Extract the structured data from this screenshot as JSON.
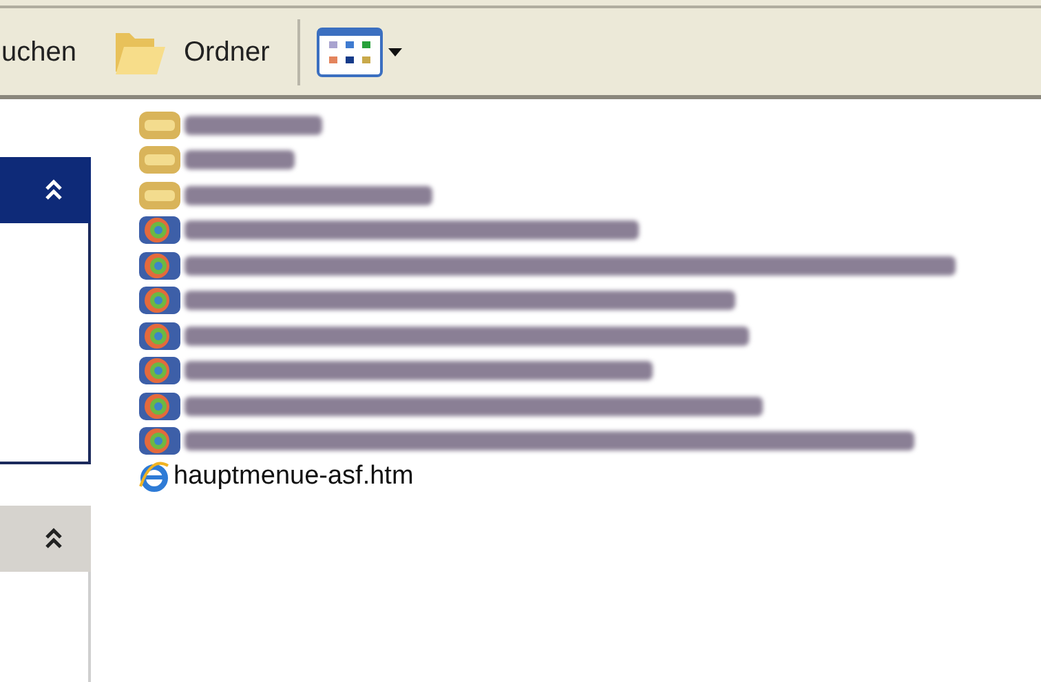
{
  "toolbar": {
    "items": [
      {
        "kind": "text",
        "label": "uchen"
      },
      {
        "kind": "folders",
        "label": "Ordner"
      },
      {
        "kind": "views"
      }
    ]
  },
  "task_panes": [
    {
      "expanded": true,
      "active": true
    },
    {
      "expanded": true,
      "active": false
    }
  ],
  "files": [
    {
      "kind": "folder",
      "blurred": true
    },
    {
      "kind": "folder",
      "blurred": true
    },
    {
      "kind": "folder",
      "blurred": true
    },
    {
      "kind": "video",
      "blurred": true
    },
    {
      "kind": "video",
      "blurred": true
    },
    {
      "kind": "video",
      "blurred": true
    },
    {
      "kind": "video",
      "blurred": true
    },
    {
      "kind": "video",
      "blurred": true
    },
    {
      "kind": "video",
      "blurred": true
    },
    {
      "kind": "video",
      "blurred": true
    },
    {
      "kind": "web",
      "blurred": false,
      "label": "hauptmenue-asf.htm"
    }
  ]
}
